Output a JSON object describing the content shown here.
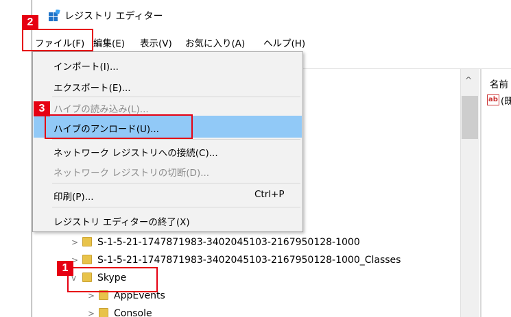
{
  "window": {
    "title": "レジストリ エディター"
  },
  "menubar": [
    {
      "label": "ファイル(F)"
    },
    {
      "label": "編集(E)"
    },
    {
      "label": "表示(V)"
    },
    {
      "label": "お気に入り(A)"
    },
    {
      "label": "ヘルプ(H)"
    }
  ],
  "file_menu": {
    "items": [
      {
        "label": "インポート(I)...",
        "disabled": false
      },
      {
        "label": "エクスポート(E)...",
        "disabled": false
      },
      {
        "label": "ハイブの読み込み(L)...",
        "disabled": true
      },
      {
        "label": "ハイブのアンロード(U)...",
        "disabled": false,
        "highlighted": true
      },
      {
        "label": "ネットワーク レジストリへの接続(C)...",
        "disabled": false
      },
      {
        "label": "ネットワーク レジストリの切断(D)...",
        "disabled": true
      },
      {
        "label": "印刷(P)...",
        "shortcut": "Ctrl+P",
        "disabled": false
      },
      {
        "label": "レジストリ エディターの終了(X)",
        "disabled": false
      }
    ]
  },
  "tree": [
    {
      "label": "S-1-5-21-1747871983-3402045103-2167950128-1000",
      "expand": ">"
    },
    {
      "label": "S-1-5-21-1747871983-3402045103-2167950128-1000_Classes",
      "expand": ">"
    },
    {
      "label": "Skype",
      "expand": "v"
    },
    {
      "label": "AppEvents",
      "expand": ">"
    },
    {
      "label": "Console",
      "expand": ">"
    }
  ],
  "right_pane": {
    "header": "名前",
    "first_value_truncated": "(既"
  },
  "annotations": [
    {
      "number": "1"
    },
    {
      "number": "2"
    },
    {
      "number": "3"
    }
  ],
  "colors": {
    "annotation": "#e60012",
    "highlight": "#91c9f7",
    "folder": "#e8c34a"
  }
}
